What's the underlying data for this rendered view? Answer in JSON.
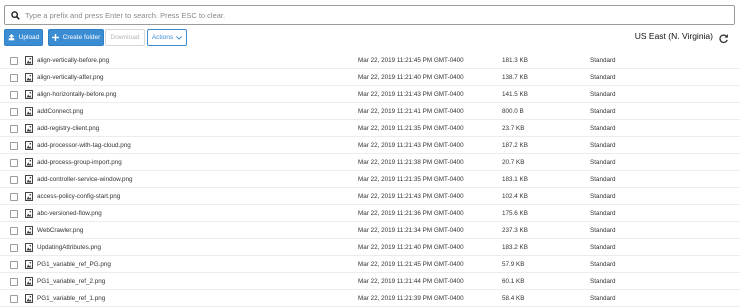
{
  "search": {
    "placeholder": "Type a prefix and press Enter to search. Press ESC to clear."
  },
  "toolbar": {
    "upload_label": "Upload",
    "create_folder_label": "Create folder",
    "download_label": "Download",
    "actions_label": "Actions",
    "region_label": "US East (N. Virginia)"
  },
  "colors": {
    "accent": "#3b8dd3",
    "row_border": "#ececec"
  },
  "files": [
    {
      "name": "align-vertically-before.png",
      "date": "Mar 22, 2019 11:21:45 PM GMT-0400",
      "size": "181.3 KB",
      "class": "Standard"
    },
    {
      "name": "align-vertically-after.png",
      "date": "Mar 22, 2019 11:21:40 PM GMT-0400",
      "size": "138.7 KB",
      "class": "Standard"
    },
    {
      "name": "align-horizontally-before.png",
      "date": "Mar 22, 2019 11:21:43 PM GMT-0400",
      "size": "141.5 KB",
      "class": "Standard"
    },
    {
      "name": "addConnect.png",
      "date": "Mar 22, 2019 11:21:41 PM GMT-0400",
      "size": "800.0 B",
      "class": "Standard"
    },
    {
      "name": "add-registry-client.png",
      "date": "Mar 22, 2019 11:21:35 PM GMT-0400",
      "size": "23.7 KB",
      "class": "Standard"
    },
    {
      "name": "add-processor-with-tag-cloud.png",
      "date": "Mar 22, 2019 11:21:43 PM GMT-0400",
      "size": "187.2 KB",
      "class": "Standard"
    },
    {
      "name": "add-process-group-import.png",
      "date": "Mar 22, 2019 11:21:38 PM GMT-0400",
      "size": "20.7 KB",
      "class": "Standard"
    },
    {
      "name": "add-controller-service-window.png",
      "date": "Mar 22, 2019 11:21:35 PM GMT-0400",
      "size": "183.1 KB",
      "class": "Standard"
    },
    {
      "name": "access-policy-config-start.png",
      "date": "Mar 22, 2019 11:21:43 PM GMT-0400",
      "size": "102.4 KB",
      "class": "Standard"
    },
    {
      "name": "abc-versioned-flow.png",
      "date": "Mar 22, 2019 11:21:36 PM GMT-0400",
      "size": "175.6 KB",
      "class": "Standard"
    },
    {
      "name": "WebCrawler.png",
      "date": "Mar 22, 2019 11:21:34 PM GMT-0400",
      "size": "237.3 KB",
      "class": "Standard"
    },
    {
      "name": "UpdatingAttributes.png",
      "date": "Mar 22, 2019 11:21:40 PM GMT-0400",
      "size": "183.2 KB",
      "class": "Standard"
    },
    {
      "name": "PG1_variable_ref_PG.png",
      "date": "Mar 22, 2019 11:21:45 PM GMT-0400",
      "size": "57.9 KB",
      "class": "Standard"
    },
    {
      "name": "PG1_variable_ref_2.png",
      "date": "Mar 22, 2019 11:21:44 PM GMT-0400",
      "size": "60.1 KB",
      "class": "Standard"
    },
    {
      "name": "PG1_variable_ref_1.png",
      "date": "Mar 22, 2019 11:21:39 PM GMT-0400",
      "size": "58.4 KB",
      "class": "Standard"
    }
  ]
}
